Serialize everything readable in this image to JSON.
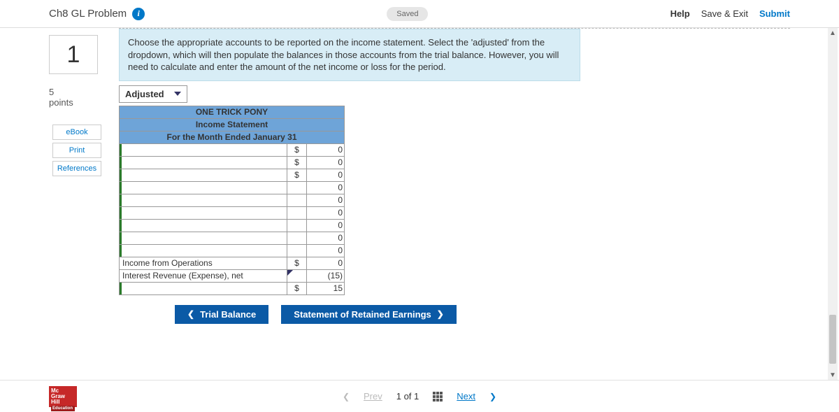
{
  "topbar": {
    "title": "Ch8 GL Problem",
    "saved": "Saved",
    "help": "Help",
    "save_exit": "Save & Exit",
    "submit": "Submit"
  },
  "sidebar": {
    "qnum": "1",
    "points_num": "5",
    "points_label": "points",
    "links": {
      "ebook": "eBook",
      "print": "Print",
      "refs": "References"
    }
  },
  "instructions": "Choose the appropriate accounts to be reported on the income statement. Select the 'adjusted' from the dropdown, which will then populate the balances in those accounts from the trial balance. However, you will need to calculate and enter the amount of the net income or loss for the period.",
  "adjusted": {
    "label": "Adjusted"
  },
  "sheet": {
    "h1": "ONE TRICK PONY",
    "h2": "Income Statement",
    "h3": "For the Month Ended January 31",
    "rows": [
      {
        "acct": "",
        "sym": "$",
        "amt": "0",
        "dd": true
      },
      {
        "acct": "",
        "sym": "$",
        "amt": "0",
        "dd": true
      },
      {
        "acct": "",
        "sym": "$",
        "amt": "0",
        "dd": true
      },
      {
        "acct": "",
        "sym": "",
        "amt": "0",
        "dd": true
      },
      {
        "acct": "",
        "sym": "",
        "amt": "0",
        "dd": true
      },
      {
        "acct": "",
        "sym": "",
        "amt": "0",
        "dd": true
      },
      {
        "acct": "",
        "sym": "",
        "amt": "0",
        "dd": true
      },
      {
        "acct": "",
        "sym": "",
        "amt": "0",
        "dd": true
      },
      {
        "acct": "",
        "sym": "",
        "amt": "0",
        "dd": true
      },
      {
        "acct": "Income from Operations",
        "sym": "$",
        "amt": "0",
        "dd": false
      },
      {
        "acct": "Interest Revenue (Expense), net",
        "sym": "",
        "amt": "(15)",
        "dd": false,
        "symdd": true
      },
      {
        "acct": "",
        "sym": "$",
        "amt": "15",
        "dd": true
      }
    ]
  },
  "nav": {
    "prev": "Trial Balance",
    "next": "Statement of Retained Earnings"
  },
  "pager": {
    "prev": "Prev",
    "pos": "1 of 1",
    "next": "Next"
  },
  "logo": {
    "l1": "Mc",
    "l2": "Graw",
    "l3": "Hill",
    "l4": "Education"
  }
}
